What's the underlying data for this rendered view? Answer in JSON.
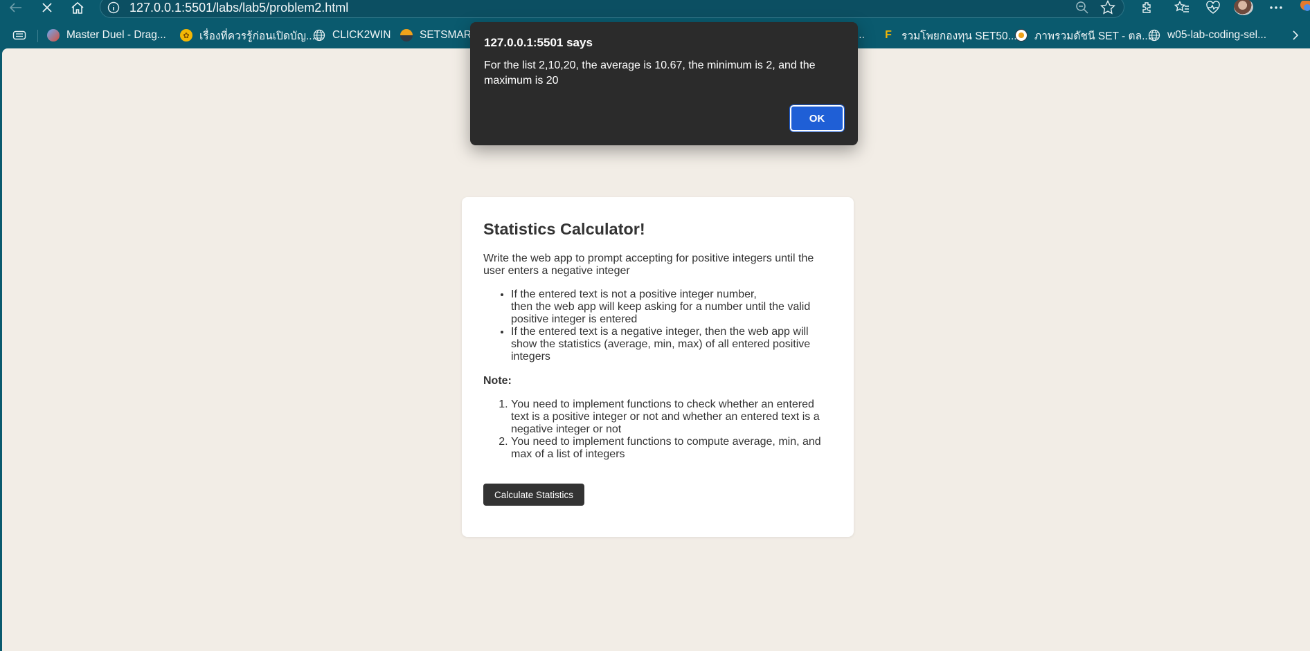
{
  "browser": {
    "url": "127.0.0.1:5501/labs/lab5/problem2.html",
    "bookmarks": [
      "Master Duel - Drag...",
      "เรื่องที่ควรรู้ก่อนเปิดบัญ...",
      "CLICK2WIN",
      "SETSMART",
      "...",
      "รวมโพยกองทุน SET50...",
      "ภาพรวมดัชนี SET - ตล...",
      "w05-lab-coding-sel..."
    ]
  },
  "dialog": {
    "title": "127.0.0.1:5501 says",
    "message": "For the list 2,10,20, the average is 10.67, the minimum is 2, and the maximum is 20",
    "ok_label": "OK"
  },
  "page": {
    "heading": "Statistics Calculator!",
    "intro": "Write the web app to prompt accepting for positive integers until the user enters a negative integer",
    "rules": [
      "If the entered text is not a positive integer number,",
      "then the web app will keep asking for a number until the valid positive integer is entered",
      "If the entered text is a negative integer, then the web app will show the statistics (average, min, max) of all entered positive integers"
    ],
    "note_label": "Note:",
    "notes": [
      "You need to implement functions to check whether an entered text is a positive integer or not and whether an entered text is a negative integer or not",
      "You need to implement functions to compute average, min, and max of a list of integers"
    ],
    "button_label": "Calculate Statistics"
  },
  "colors": {
    "chrome": "#0a5a6e",
    "page_background": "#f2ede6",
    "dialog_background": "#2b2b2b",
    "ok_button": "#1f5fd6",
    "button_dark": "#333333"
  }
}
